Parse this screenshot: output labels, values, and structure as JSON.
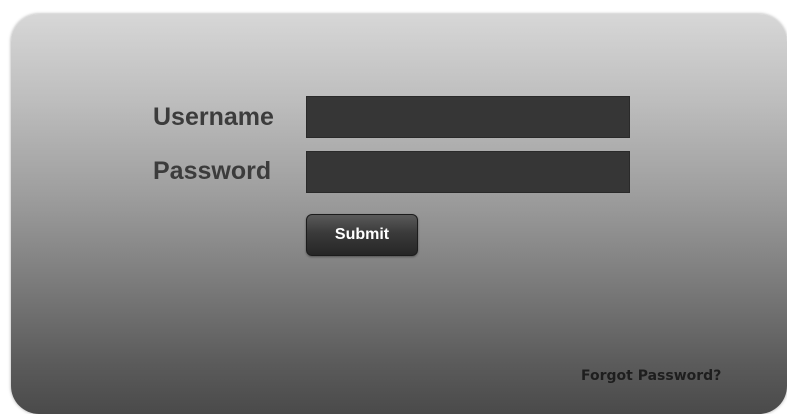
{
  "login": {
    "username_label": "Username",
    "username_value": "",
    "password_label": "Password",
    "password_value": "",
    "submit_label": "Submit",
    "forgot_password_label": "Forgot Password?"
  },
  "colors": {
    "panel_top": "#d7d7d7",
    "panel_bottom": "#4a4a4a",
    "input_background": "#363636",
    "button_background": "#333333",
    "label_text": "#3c3c3c"
  }
}
